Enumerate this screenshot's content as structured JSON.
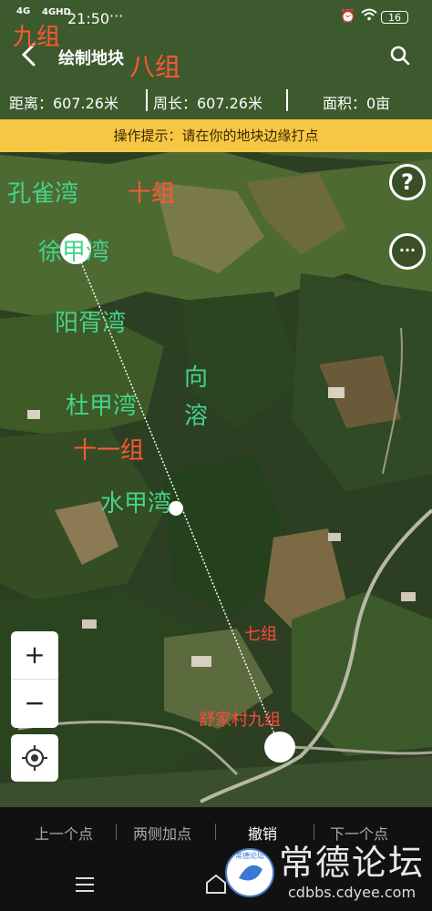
{
  "status_bar": {
    "network1": "4G",
    "network2": "4GHD",
    "time": "21:50",
    "dots": "···",
    "battery": "16"
  },
  "header": {
    "title": "绘制地块",
    "back_icon": "chevron-left-icon",
    "search_icon": "search-icon"
  },
  "stats": {
    "distance": "距离：607.26米",
    "perimeter": "周长：607.26米",
    "area": "面积：0亩"
  },
  "hint": "操作提示：请在你的地块边缘打点",
  "map_labels": {
    "jiuzu_top": "九组",
    "bazu": "八组",
    "kongquewan": "孔雀湾",
    "shizu": "十组",
    "xujiawan": "徐甲湾",
    "yangshuwan": "阳胥湾",
    "xiang": "向",
    "rong": "溶",
    "dujiawan": "杜甲湾",
    "shiyizu": "十一组",
    "shuijiawan": "水甲湾",
    "qizu": "七组",
    "shujiacun": "舒家村九组"
  },
  "side_buttons": {
    "help": "?",
    "more": "···"
  },
  "zoom": {
    "in": "+",
    "out": "−"
  },
  "bottom_actions": {
    "prev": "上一个点",
    "both_sides": "两侧加点",
    "undo": "撤销",
    "next": "下一个点"
  },
  "watermark": {
    "text": "常德论坛",
    "url": "cdbbs.cdyee.com",
    "logo_text": "常德论坛"
  },
  "colors": {
    "hint_bg": "#f7c744",
    "label_green": "#44d38a",
    "label_red": "#ff5733"
  }
}
